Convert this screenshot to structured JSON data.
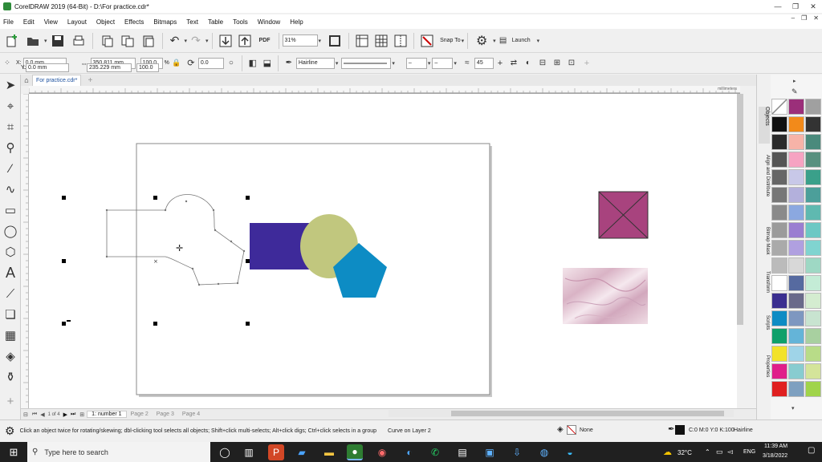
{
  "window": {
    "title": "CorelDRAW 2019 (64-Bit) - D:\\For practice.cdr*",
    "controls": [
      "—",
      "❐",
      "✕"
    ]
  },
  "menu": [
    "File",
    "Edit",
    "View",
    "Layout",
    "Object",
    "Effects",
    "Bitmaps",
    "Text",
    "Table",
    "Tools",
    "Window",
    "Help"
  ],
  "toolbar": {
    "zoom": "31%",
    "snap_to": "Snap To",
    "launch": "Launch",
    "pdf": "PDF"
  },
  "property_bar": {
    "x": "0.0 mm",
    "y": "0.0 mm",
    "width": "350.811 mm",
    "height": "235.229 mm",
    "scale_x": "100.0",
    "scale_y": "100.0",
    "pct": "%",
    "rotation": "0.0",
    "outline": "Hairline",
    "angle": "45"
  },
  "document_tab": "For practice.cdr*",
  "ruler_unit": "millimeters",
  "pages": [
    "1: number 1",
    "Page 2",
    "Page 3",
    "Page 4"
  ],
  "page_nav": "1 of 4",
  "dockers": [
    "Objects",
    "Align and Distribute",
    "Bitmap Mask",
    "Transform",
    "Scripts",
    "Properties"
  ],
  "status": {
    "hint": "Click an object twice for rotating/skewing; dbl-clicking tool selects all objects; Shift+click multi-selects; Alt+click digs; Ctrl+click selects in a group",
    "layer": "Curve on Layer 2",
    "fill": "None",
    "outline_color": "C:0 M:0 Y:0 K:100",
    "outline_width": "Hairline"
  },
  "taskbar": {
    "search_placeholder": "Type here to search",
    "temperature": "32°C",
    "language": "ENG",
    "time": "11:39 AM",
    "date": "3/18/2022"
  },
  "colors": {
    "rectangle": "#3e2a9a",
    "circle": "#c1c77e",
    "pentagon": "#0d8cc4",
    "square": "#a8437e",
    "texture": "#e8cfd8"
  },
  "palette": [
    "#ffffff",
    "#9b2f7a",
    "#a0a0a0",
    "#111111",
    "#f28a1a",
    "#333333",
    "#2b2b2b",
    "#f7b3a8",
    "#4a8a7c",
    "#555555",
    "#f6a3c2",
    "#58907f",
    "#666666",
    "#c8c8e8",
    "#3aa08a",
    "#777777",
    "#b3b0dc",
    "#4c9f9a",
    "#8a8a8a",
    "#8ba8e0",
    "#5fb9b0",
    "#9b9b9b",
    "#9a7ed1",
    "#6cc8c4",
    "#aaaaaa",
    "#b0a0e0",
    "#80d4d0",
    "#bbbbbb",
    "#d8d8d8",
    "#9ed8c4",
    "#ffffff",
    "#566aa0",
    "#c4ecd6",
    "#3b2f90",
    "#6a6a8a",
    "#d4ecd0",
    "#0e8cc4",
    "#7e97c0",
    "#c8e4d0",
    "#0fa06a",
    "#64b4d8",
    "#a8d0a0",
    "#f2e22a",
    "#9fd4e8",
    "#b8dc88",
    "#e01e8a",
    "#88ccd0",
    "#d4e49a",
    "#e02020",
    "#7ea0c0",
    "#a0d44a"
  ]
}
